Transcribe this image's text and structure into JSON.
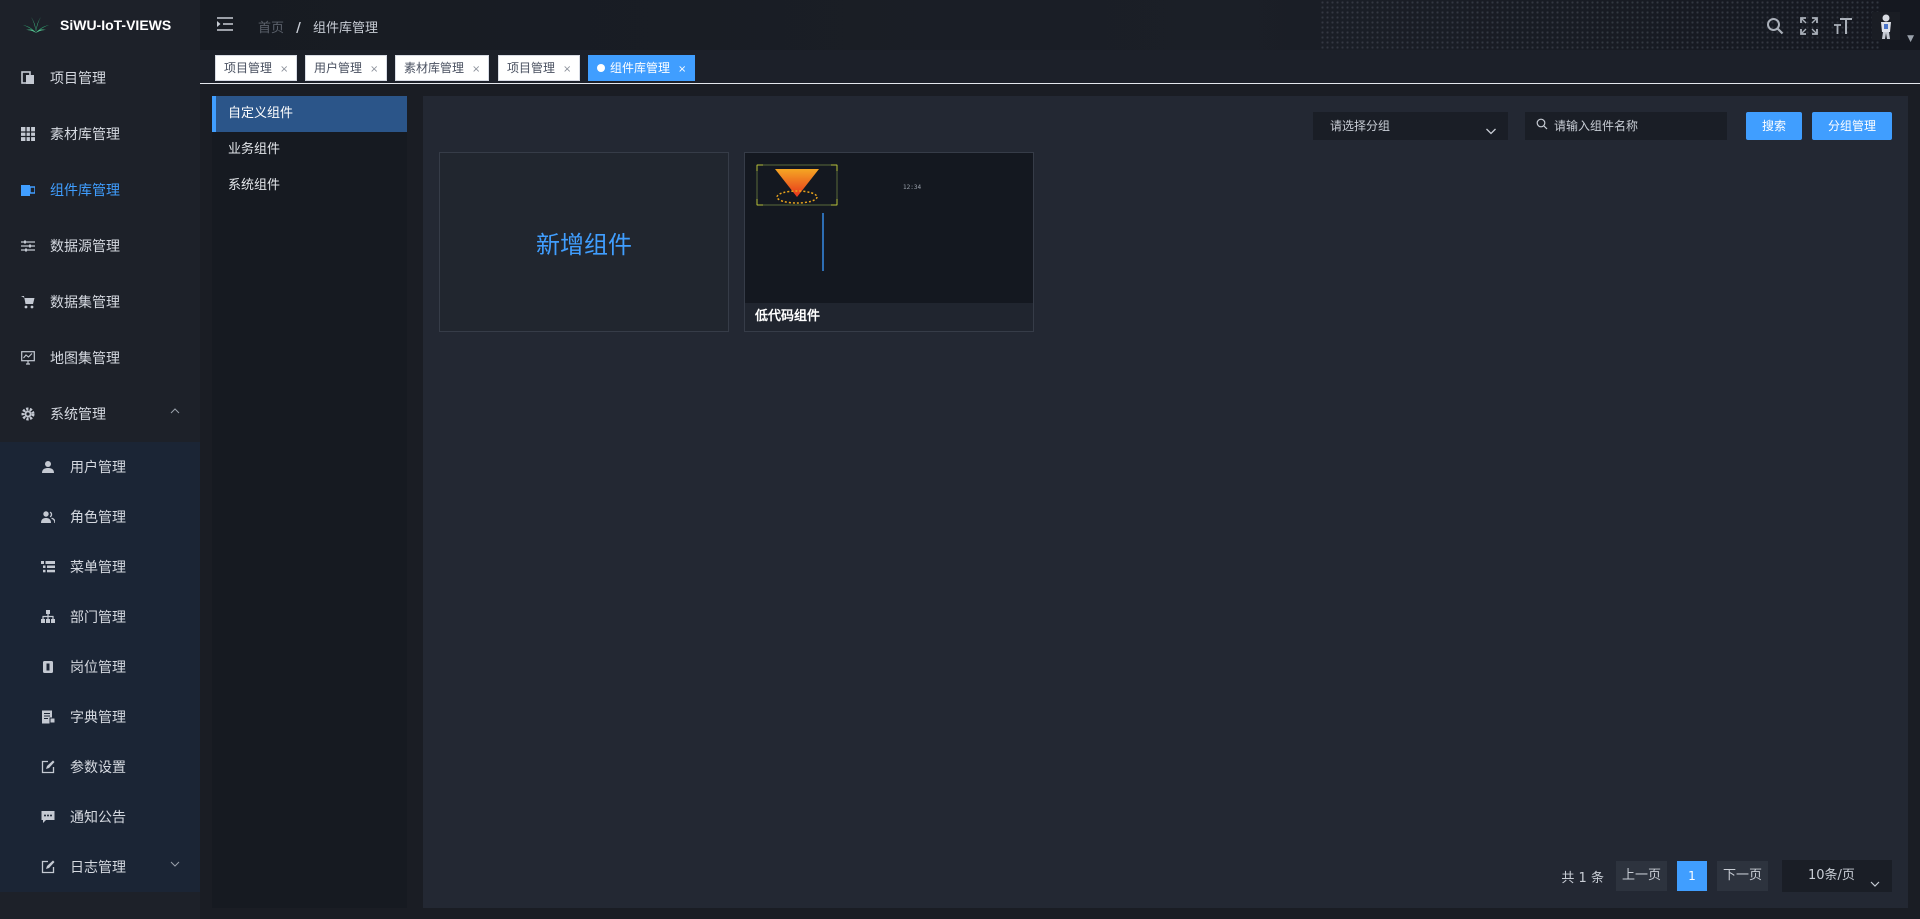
{
  "brand": {
    "name": "SiWU-IoT-VIEWS"
  },
  "sidebar": {
    "items": [
      {
        "label": "项目管理",
        "icon": "document-icon"
      },
      {
        "label": "素材库管理",
        "icon": "grid-icon"
      },
      {
        "label": "组件库管理",
        "icon": "component-icon",
        "active": true
      },
      {
        "label": "数据源管理",
        "icon": "sliders-icon"
      },
      {
        "label": "数据集管理",
        "icon": "cart-icon"
      },
      {
        "label": "地图集管理",
        "icon": "monitor-chart-icon"
      },
      {
        "label": "系统管理",
        "icon": "gear-icon",
        "expanded": true
      }
    ],
    "sub_items": [
      {
        "label": "用户管理",
        "icon": "user-icon"
      },
      {
        "label": "角色管理",
        "icon": "users-icon"
      },
      {
        "label": "菜单管理",
        "icon": "tree-table-icon"
      },
      {
        "label": "部门管理",
        "icon": "org-tree-icon"
      },
      {
        "label": "岗位管理",
        "icon": "post-icon"
      },
      {
        "label": "字典管理",
        "icon": "dictionary-icon"
      },
      {
        "label": "参数设置",
        "icon": "edit-icon"
      },
      {
        "label": "通知公告",
        "icon": "message-icon"
      },
      {
        "label": "日志管理",
        "icon": "log-icon"
      }
    ]
  },
  "header": {
    "breadcrumb": {
      "home": "首页",
      "separator": "/",
      "current": "组件库管理"
    }
  },
  "tags": [
    {
      "label": "项目管理"
    },
    {
      "label": "用户管理"
    },
    {
      "label": "素材库管理"
    },
    {
      "label": "项目管理"
    },
    {
      "label": "组件库管理",
      "active": true
    }
  ],
  "categories": [
    {
      "label": "自定义组件",
      "active": true
    },
    {
      "label": "业务组件"
    },
    {
      "label": "系统组件"
    }
  ],
  "toolbar": {
    "group_select": "请选择分组",
    "search_placeholder": "请输入组件名称",
    "search_button": "搜索",
    "group_button": "分组管理"
  },
  "cards": {
    "add_label": "新增组件",
    "items": [
      {
        "name": "低代码组件",
        "thumb_text": "12:34"
      }
    ]
  },
  "pagination": {
    "total": "共 1 条",
    "prev": "上一页",
    "current": "1",
    "next": "下一页",
    "page_size": "10条/页"
  },
  "colors": {
    "accent": "#409eff",
    "sidebar_bg": "#1d2129",
    "panel_bg": "#232833"
  }
}
